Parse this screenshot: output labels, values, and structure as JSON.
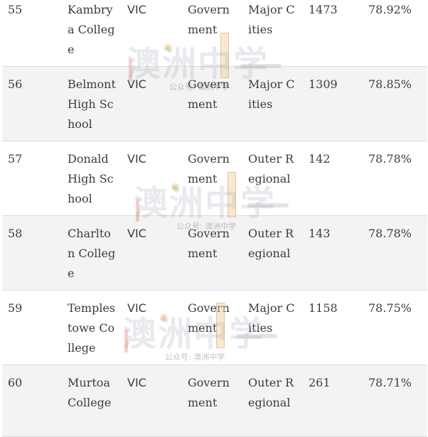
{
  "rows": [
    {
      "rank": "55",
      "school": "Kambrya College",
      "state": "VIC",
      "sector": "Government",
      "region": "Major Cities",
      "enrolment": "1473",
      "percent": "78.92%"
    },
    {
      "rank": "56",
      "school": "Belmont High School",
      "state": "VIC",
      "sector": "Government",
      "region": "Major Cities",
      "enrolment": "1309",
      "percent": "78.85%"
    },
    {
      "rank": "57",
      "school": "Donald High School",
      "state": "VIC",
      "sector": "Government",
      "region": "Outer Regional",
      "enrolment": "142",
      "percent": "78.78%"
    },
    {
      "rank": "58",
      "school": "Charlton College",
      "state": "VIC",
      "sector": "Government",
      "region": "Outer Regional",
      "enrolment": "143",
      "percent": "78.78%"
    },
    {
      "rank": "59",
      "school": "Templestowe College",
      "state": "VIC",
      "sector": "Government",
      "region": "Major Cities",
      "enrolment": "1158",
      "percent": "78.75%"
    },
    {
      "rank": "60",
      "school": "Murtoa College",
      "state": "VIC",
      "sector": "Government",
      "region": "Outer Regional",
      "enrolment": "261",
      "percent": "78.71%"
    }
  ],
  "watermark": {
    "logo_text": "澳洲中学",
    "caption": "公众号: 澳洲中学"
  }
}
